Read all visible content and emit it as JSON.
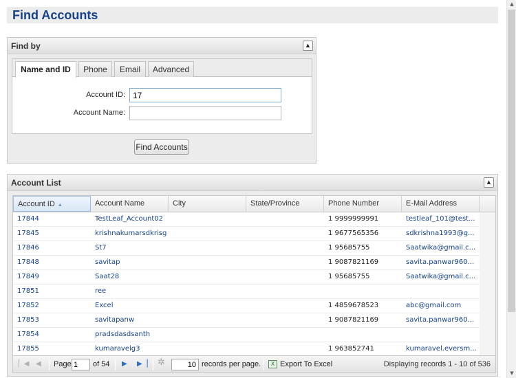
{
  "page": {
    "title": "Find Accounts"
  },
  "find_panel": {
    "title": "Find by",
    "tabs": [
      {
        "label": "Name and ID",
        "active": true
      },
      {
        "label": "Phone",
        "active": false
      },
      {
        "label": "Email",
        "active": false
      },
      {
        "label": "Advanced",
        "active": false
      }
    ],
    "account_id_label": "Account ID:",
    "account_id_value": "17",
    "account_name_label": "Account Name:",
    "account_name_value": "",
    "find_button": "Find Accounts"
  },
  "list_panel": {
    "title": "Account List",
    "columns": [
      "Account ID",
      "Account Name",
      "City",
      "State/Province",
      "Phone Number",
      "E-Mail Address"
    ],
    "sorted_column": "Account ID",
    "sort_direction": "ascending",
    "rows": [
      {
        "id": "17844",
        "name": "TestLeaf_Account02",
        "city": "",
        "state": "",
        "phone": "1 9999999991",
        "email": "testleaf_101@test..."
      },
      {
        "id": "17845",
        "name": "krishnakumarsdkrisg",
        "city": "",
        "state": "",
        "phone": "1 9677565356",
        "email": "sdkrishna1993@g..."
      },
      {
        "id": "17846",
        "name": "St7",
        "city": "",
        "state": "",
        "phone": "1 95685755",
        "email": "Saatwika@gmail.c..."
      },
      {
        "id": "17848",
        "name": "savitap",
        "city": "",
        "state": "",
        "phone": "1 9087821169",
        "email": "savita.panwar960..."
      },
      {
        "id": "17849",
        "name": "Saat28",
        "city": "",
        "state": "",
        "phone": "1 95685755",
        "email": "Saatwika@gmail.c..."
      },
      {
        "id": "17851",
        "name": "ree",
        "city": "",
        "state": "",
        "phone": "",
        "email": ""
      },
      {
        "id": "17852",
        "name": "Excel",
        "city": "",
        "state": "",
        "phone": "1 4859678523",
        "email": "abc@gmail.com"
      },
      {
        "id": "17853",
        "name": "savitapanw",
        "city": "",
        "state": "",
        "phone": "1 9087821169",
        "email": "savita.panwar960..."
      },
      {
        "id": "17854",
        "name": "pradsdasdsanth",
        "city": "",
        "state": "",
        "phone": "",
        "email": ""
      },
      {
        "id": "17855",
        "name": "kumaravelg3",
        "city": "",
        "state": "",
        "phone": "1 963852741",
        "email": "kumaravel.eversm..."
      }
    ]
  },
  "pager": {
    "page_label": "Page",
    "current_page": "1",
    "of_label": "of 54",
    "records_per_page_value": "10",
    "records_per_page_label": "records per page.",
    "export_label": "Export To Excel",
    "display_text": "Displaying records 1 - 10 of 536"
  },
  "colors": {
    "title": "#15428b",
    "link": "#15428b"
  },
  "icons": [
    "first-page-icon",
    "prev-page-icon",
    "next-page-icon",
    "last-page-icon",
    "refresh-icon",
    "excel-icon",
    "collapse-icon",
    "sort-asc-icon"
  ]
}
